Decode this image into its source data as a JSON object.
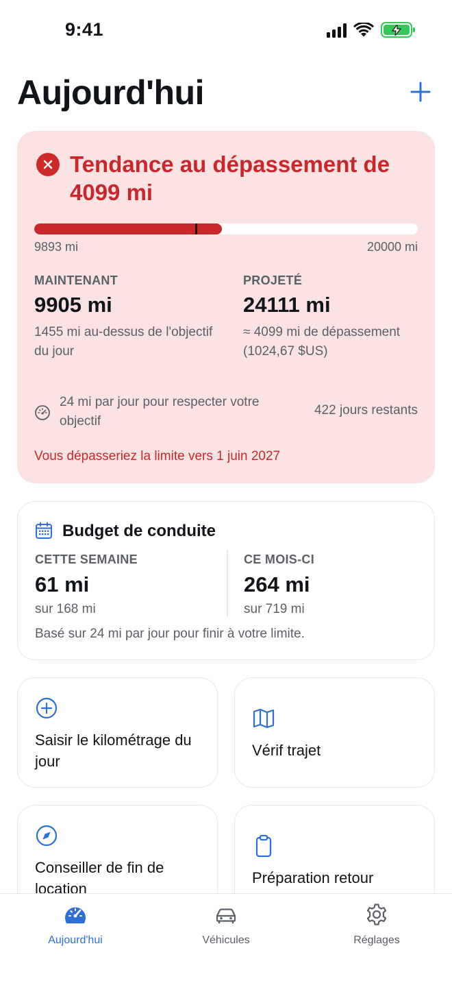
{
  "status_bar": {
    "time": "9:41"
  },
  "header": {
    "title": "Aujourd'hui"
  },
  "alert": {
    "title": "Tendance au dépassement de 4099 mi",
    "progress": {
      "min_label": "9893 mi",
      "max_label": "20000 mi",
      "fill_fraction": 0.49,
      "marker_fraction": 0.42
    },
    "now": {
      "label": "MAINTENANT",
      "value": "9905 mi",
      "sub": "1455 mi au-dessus de l'objectif du jour"
    },
    "projected": {
      "label": "PROJETÉ",
      "value": "24111 mi",
      "sub": "≈ 4099 mi de dépassement (1024,67 $US)"
    },
    "pace_text": "24 mi par jour pour respecter votre objectif",
    "days_left": "422 jours restants",
    "exceed_note": "Vous dépasseriez la limite vers 1 juin 2027"
  },
  "budget": {
    "title": "Budget de conduite",
    "week": {
      "label": "CETTE SEMAINE",
      "value": "61 mi",
      "sub": "sur 168 mi"
    },
    "month": {
      "label": "CE MOIS-CI",
      "value": "264 mi",
      "sub": "sur 719 mi"
    },
    "note": "Basé sur 24 mi par jour pour finir à votre limite."
  },
  "tiles": [
    {
      "label": "Saisir le kilométrage du jour",
      "icon": "plus-circle-icon"
    },
    {
      "label": "Vérif trajet",
      "icon": "map-icon"
    },
    {
      "label": "Conseiller de fin de location",
      "icon": "compass-icon"
    },
    {
      "label": "Préparation retour",
      "icon": "clipboard-icon"
    }
  ],
  "tabs": [
    {
      "label": "Aujourd'hui",
      "icon": "gauge-icon",
      "active": true
    },
    {
      "label": "Véhicules",
      "icon": "car-icon",
      "active": false
    },
    {
      "label": "Réglages",
      "icon": "gear-icon",
      "active": false
    }
  ],
  "colors": {
    "accent": "#2d6fd6",
    "danger": "#c8282b",
    "danger_bg": "#fbe3e4",
    "muted": "#5b5f66",
    "battery": "#34c759"
  }
}
